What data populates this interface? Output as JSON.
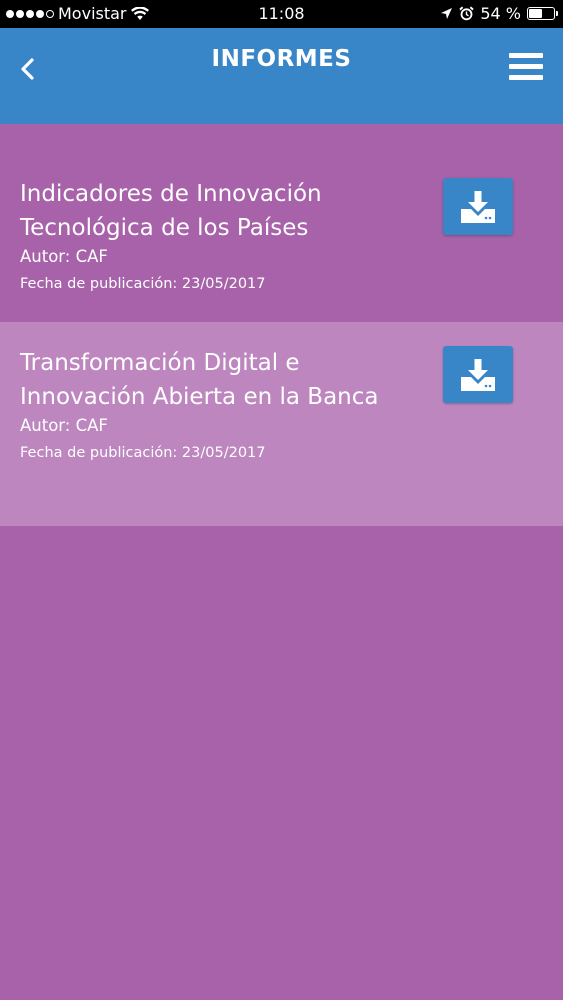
{
  "status_bar": {
    "carrier": "Movistar",
    "time": "11:08",
    "battery": "54 %",
    "battery_level": 0.54,
    "icons": [
      "signal-dots-icon",
      "wifi-icon",
      "location-arrow-icon",
      "alarm-icon",
      "battery-icon"
    ]
  },
  "header": {
    "title": "INFORMES",
    "back_icon": "chevron-left-icon",
    "menu_icon": "hamburger-menu-icon"
  },
  "reports": [
    {
      "title": "Indicadores de Innovación Tecnológica de los Países",
      "author": "Autor: CAF",
      "date": "Fecha de publicación: 23/05/2017",
      "icon": "download-icon"
    },
    {
      "title": "Transformación Digital e Innovación Abierta en la Banca",
      "author": "Autor: CAF",
      "date": "Fecha de publicación: 23/05/2017",
      "icon": "download-icon"
    }
  ],
  "colors": {
    "header": "#3886c8",
    "background": "#a762a9",
    "highlighted_row": "#bd86bf",
    "button": "#3886c8",
    "text": "#ffffff"
  }
}
